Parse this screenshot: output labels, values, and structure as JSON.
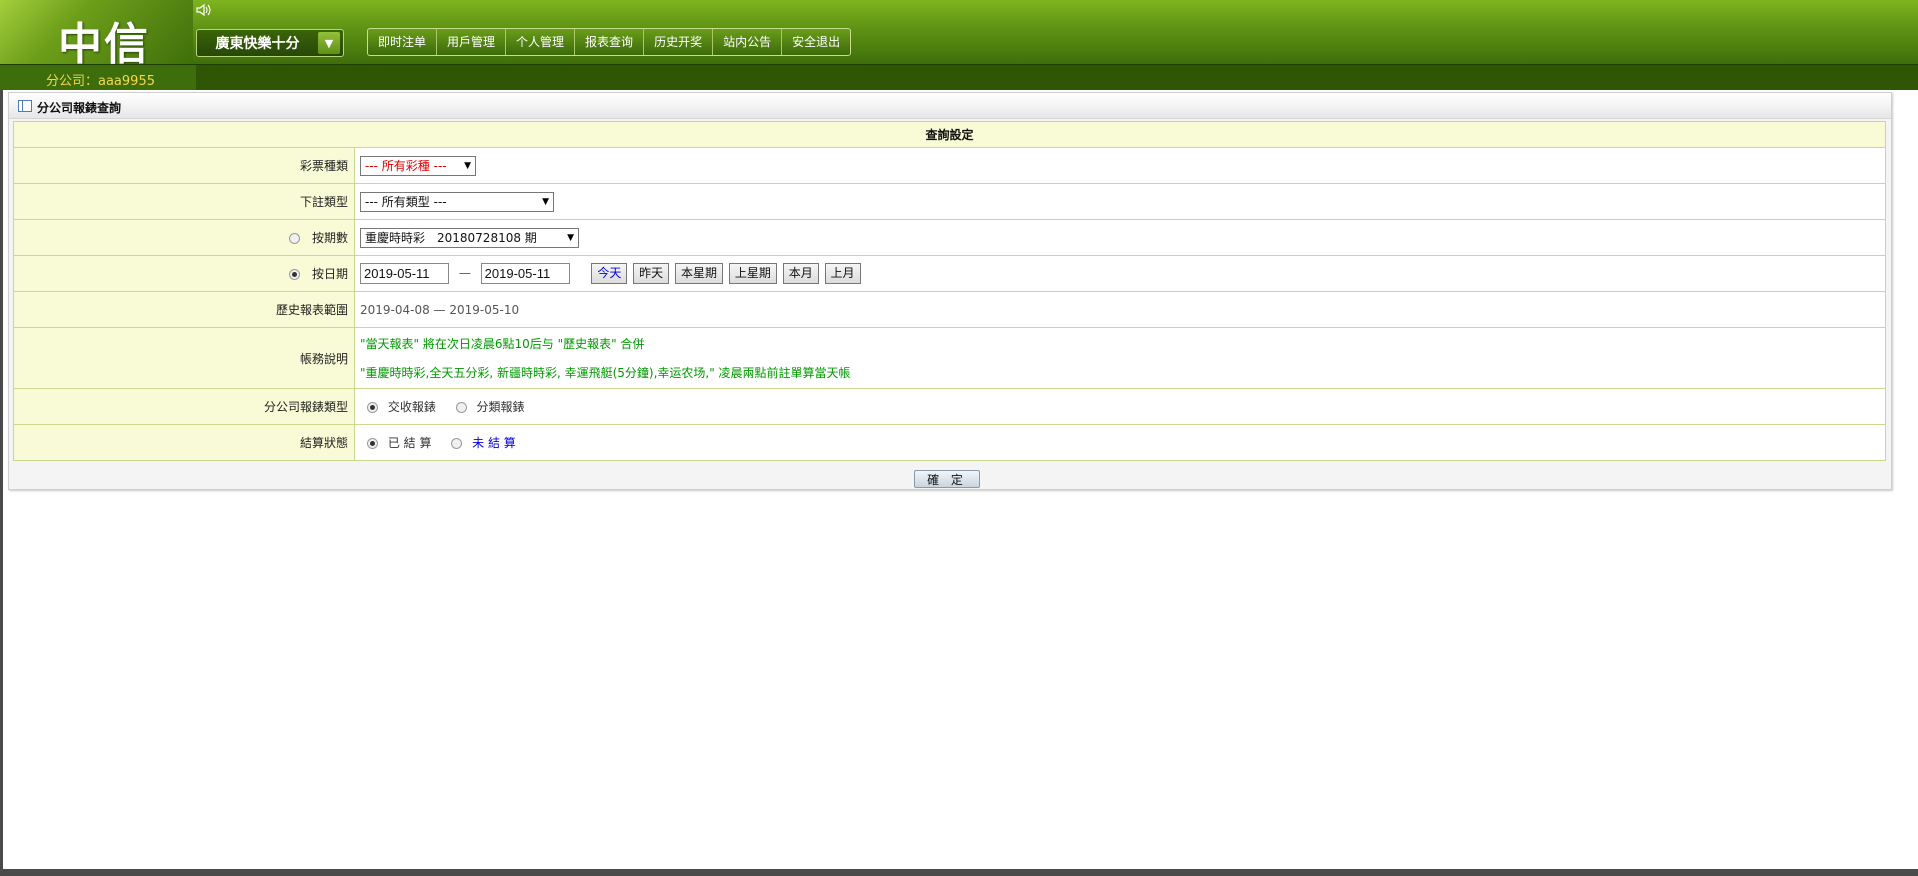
{
  "header": {
    "logo": "中信",
    "game_select": {
      "label": "廣東快樂十分"
    },
    "nav": [
      {
        "label": "即时注单"
      },
      {
        "label": "用戶管理"
      },
      {
        "label": "个人管理"
      },
      {
        "label": "报表查询"
      },
      {
        "label": "历史开奖"
      },
      {
        "label": "站内公告"
      },
      {
        "label": "安全退出"
      }
    ]
  },
  "subbar": {
    "account": "分公司：aaa9955"
  },
  "panel": {
    "title": "分公司報錶查詢",
    "section_header": "查詢設定",
    "rows": {
      "lottery": {
        "label": "彩票種類",
        "value": "--- 所有彩種 ---"
      },
      "bet_type": {
        "label": "下註類型",
        "value": "--- 所有類型 ---"
      },
      "by_period": {
        "label": "按期數",
        "value": "重慶時時彩　20180728108 期"
      },
      "by_date": {
        "label": "按日期",
        "start": "2019-05-11",
        "sep": "—",
        "end": "2019-05-11",
        "buttons": {
          "today": "今天",
          "yesterday": "昨天",
          "this_week": "本星期",
          "last_week": "上星期",
          "this_month": "本月",
          "last_month": "上月"
        }
      },
      "history_range": {
        "label": "歷史報表範圍",
        "value": "2019-04-08 — 2019-05-10"
      },
      "account_note": {
        "label": "帳務說明",
        "line1": "\"當天報表\" 將在次日凌晨6點10后与 \"歷史報表\" 合併",
        "line2": "\"重慶時時彩,全天五分彩, 新疆時時彩, 幸運飛艇(5分鐘),幸运农场,\" 凌晨兩點前註單算當天帳"
      },
      "report_type": {
        "label": "分公司報錶類型",
        "opt1": "交收報錶",
        "opt2": "分類報錶"
      },
      "settle_status": {
        "label": "結算狀態",
        "opt1": "已 結 算",
        "opt2": "未 結 算"
      }
    },
    "submit": "確 定"
  }
}
